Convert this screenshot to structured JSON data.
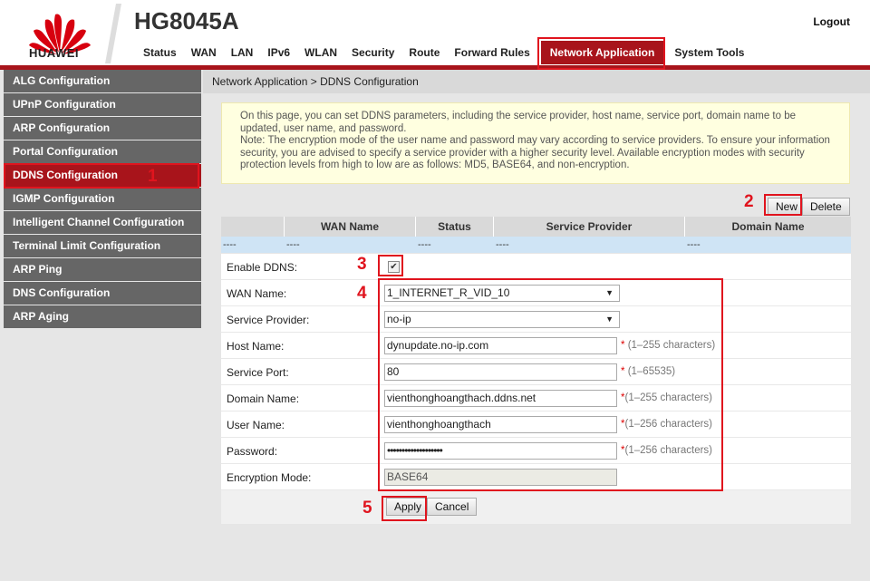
{
  "header": {
    "brand": "HUAWEI",
    "model": "HG8045A",
    "logout": "Logout",
    "nav": [
      "Status",
      "WAN",
      "LAN",
      "IPv6",
      "WLAN",
      "Security",
      "Route",
      "Forward Rules",
      "Network Application",
      "System Tools"
    ],
    "active_nav": "Network Application"
  },
  "sidebar": {
    "items": [
      "ALG Configuration",
      "UPnP Configuration",
      "ARP Configuration",
      "Portal Configuration",
      "DDNS Configuration",
      "IGMP Configuration",
      "Intelligent Channel Configuration",
      "Terminal Limit Configuration",
      "ARP Ping",
      "DNS Configuration",
      "ARP Aging"
    ],
    "active": "DDNS Configuration"
  },
  "breadcrumb": "Network Application > DDNS Configuration",
  "note": "On this page, you can set DDNS parameters, including the service provider, host name, service port, domain name to be updated, user name, and password.\nNote: The encryption mode of the user name and password may vary according to service providers. To ensure your information security, you are advised to specify a service provider with a higher security level. Available encryption modes with security protection levels from high to low are as follows: MD5, BASE64, and non-encryption.",
  "buttons": {
    "new": "New",
    "delete": "Delete",
    "apply": "Apply",
    "cancel": "Cancel"
  },
  "table": {
    "headers": [
      "",
      "WAN Name",
      "Status",
      "Service Provider",
      "Domain Name"
    ],
    "row": [
      "----",
      "----",
      "----",
      "----",
      "----"
    ]
  },
  "form": {
    "enable_label": "Enable DDNS:",
    "enable_checked": true,
    "wan_label": "WAN Name:",
    "wan_value": "1_INTERNET_R_VID_10",
    "provider_label": "Service Provider:",
    "provider_value": "no-ip",
    "host_label": "Host Name:",
    "host_value": "dynupdate.no-ip.com",
    "host_hint": "(1–255 characters)",
    "port_label": "Service Port:",
    "port_value": "80",
    "port_hint": "(1–65535)",
    "domain_label": "Domain Name:",
    "domain_value": "vienthonghoangthach.ddns.net",
    "domain_hint": "(1–255 characters)",
    "user_label": "User Name:",
    "user_value": "vienthonghoangthach",
    "user_hint": "(1–256 characters)",
    "password_label": "Password:",
    "password_value": "•••••••••••••••••••",
    "password_hint": "(1–256 characters)",
    "encryption_label": "Encryption Mode:",
    "encryption_value": "BASE64",
    "required_mark": "*"
  },
  "annotations": [
    "1",
    "2",
    "3",
    "4",
    "5"
  ],
  "colors": {
    "brand_red": "#a8141b",
    "annotation_red": "#e0141e",
    "sidebar_gray": "#666666"
  }
}
